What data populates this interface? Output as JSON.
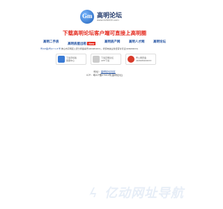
{
  "logo": {
    "mark": "Gm",
    "title": "高明论坛",
    "url": "www.626600.com"
  },
  "headline": "下载高明论坛客户端可直接上高明圈",
  "nav": {
    "links": [
      "高明二手房",
      "高明房屋出租",
      "高明房产网",
      "高明人才网",
      "高明论坛"
    ],
    "new_badge": "New"
  },
  "info_row": {
    "highlight": "粤ICP备(粤)0 7 1 8 号",
    "text": "佛山市高明区公安分局备案号(3060830XX)，增值电信业务经营许可证(3060830XX)"
  },
  "badges": [
    {
      "line1": "下载手机版",
      "line2": "客服中心",
      "color": "#3a7bd5"
    },
    {
      "line1": "下载高明论坛",
      "line2": "APP下载",
      "color": "#cccccc"
    },
    {
      "line1": "粤公网安备",
      "line2": "44060802000XX",
      "color": "#d83a2a"
    }
  ],
  "footer": {
    "line1_label": "地址：",
    "line1_link": "高明论坛社区",
    "line2": "ICP：粤ICP备07001号(高明论坛)"
  },
  "watermark": {
    "text": "亿动网址导航"
  }
}
